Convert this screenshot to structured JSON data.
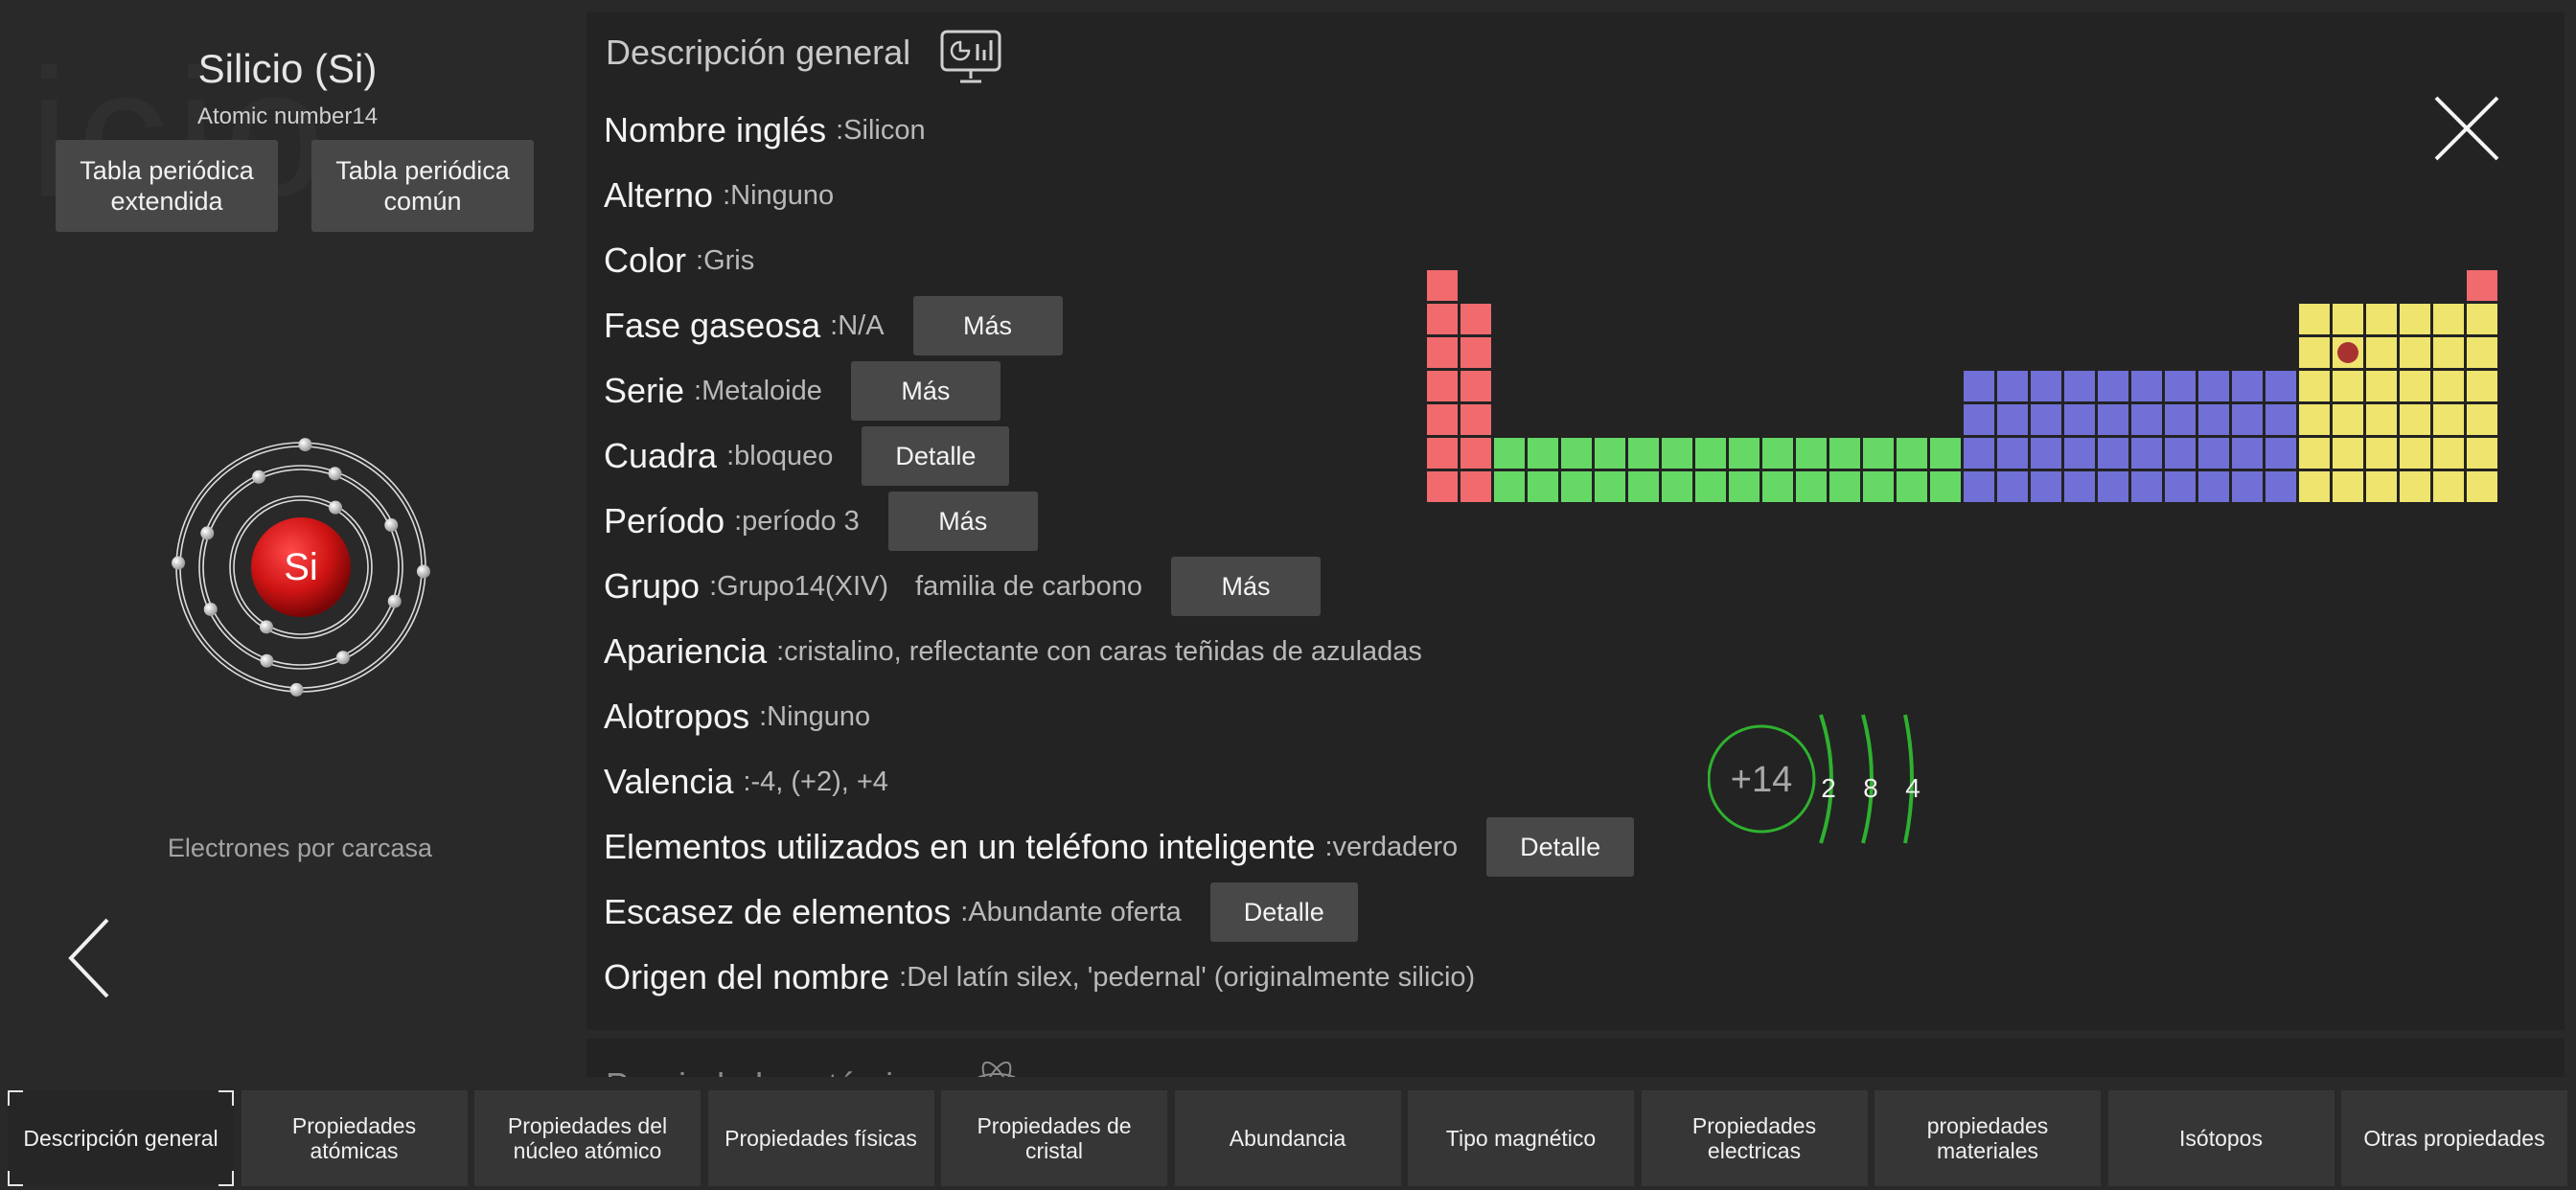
{
  "element": {
    "title": "Silicio (Si)",
    "atomic_number_label": "Atomic number14",
    "symbol": "Si",
    "ghost_text": "icio",
    "shell_label": "Electrones por carcasa"
  },
  "left_buttons": {
    "extended": "Tabla periódica\nextendida",
    "common": "Tabla periódica\ncomún"
  },
  "section": {
    "title": "Descripción general",
    "next_title": "Propiedades atómicas"
  },
  "properties": [
    {
      "key": "Nombre inglés",
      "value": ":Silicon"
    },
    {
      "key": "Alterno",
      "value": ":Ninguno"
    },
    {
      "key": "Color",
      "value": ":Gris"
    },
    {
      "key": "Fase gaseosa",
      "value": ":N/A",
      "button": "Más"
    },
    {
      "key": "Serie",
      "value": ":Metaloide",
      "button": "Más"
    },
    {
      "key": "Cuadra",
      "value": ":bloqueo",
      "button": "Detalle"
    },
    {
      "key": "Período",
      "value": ":período 3",
      "button": "Más"
    },
    {
      "key": "Grupo",
      "value": ":Grupo14(XIV)",
      "extra": "familia de carbono",
      "button": "Más"
    },
    {
      "key": "Apariencia",
      "value": ":cristalino, reflectante con caras teñidas de azuladas"
    },
    {
      "key": "Alotropos",
      "value": ":Ninguno"
    },
    {
      "key": "Valencia",
      "value": ":-4, (+2), +4"
    },
    {
      "key": "Elementos utilizados en un teléfono inteligente",
      "value": ":verdadero",
      "button": "Detalle"
    },
    {
      "key": "Escasez de elementos",
      "value": ":Abundante oferta",
      "button": "Detalle"
    },
    {
      "key": "Origen del nombre",
      "value": ":Del latín silex, 'pedernal' (originalmente silicio)"
    }
  ],
  "bohr": {
    "nucleus": "+14",
    "shells": [
      "2",
      "8",
      "4"
    ]
  },
  "colors": {
    "s_block": "#f06a6e",
    "d_block": "#66d866",
    "f_block": "#7070d6",
    "p_block": "#eee46e",
    "marker": "#a83232",
    "bohr_green": "#2fb12f"
  },
  "icons": {
    "chart": "presentation-chart-icon",
    "close": "close-icon",
    "prev": "chevron-left-icon",
    "next": "chevron-right-icon",
    "atom": "atom-icon"
  },
  "tabs": [
    "Descripción general",
    "Propiedades atómicas",
    "Propiedades del núcleo atómico",
    "Propiedades físicas",
    "Propiedades de cristal",
    "Abundancia",
    "Tipo magnético",
    "Propiedades electricas",
    "propiedades materiales",
    "Isótopos",
    "Otras propiedades"
  ]
}
